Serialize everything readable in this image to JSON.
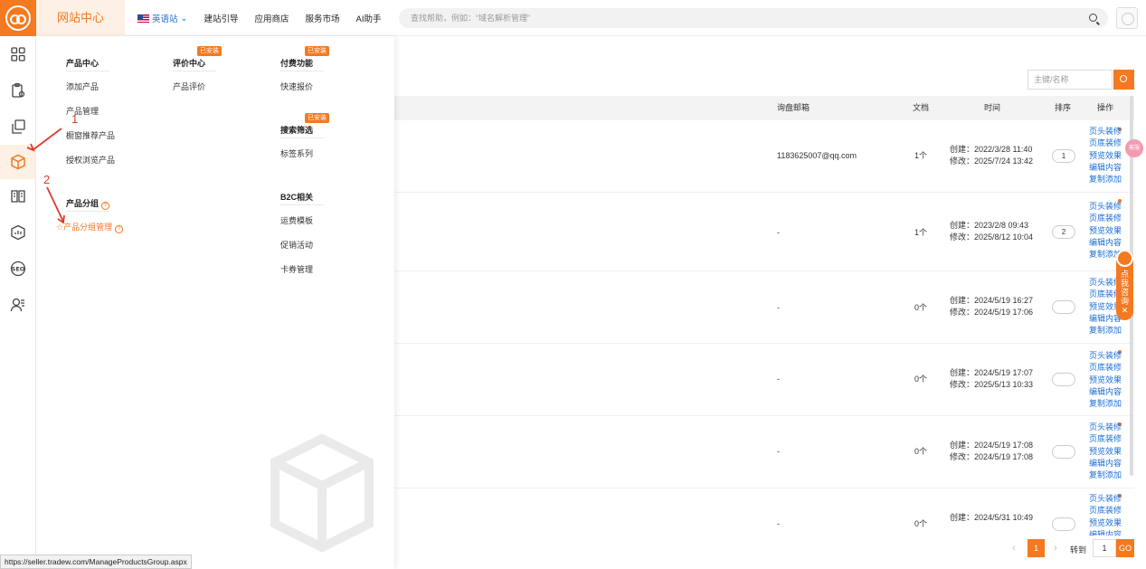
{
  "header": {
    "brand": "网站中心",
    "site_selector": "英语站",
    "nav": [
      "建站引导",
      "应用商店",
      "服务市场",
      "AI助手"
    ],
    "search_placeholder": "查找帮助，例如：“域名解析管理”"
  },
  "menu": {
    "col1": {
      "title": "产品中心",
      "items": [
        "添加产品",
        "产品管理",
        "橱窗推荐产品",
        "授权浏览产品"
      ],
      "group_title": "产品分组",
      "group_item": "产品分组管理"
    },
    "col2": {
      "badge": "已安装",
      "title": "评价中心",
      "items": [
        "产品评价"
      ]
    },
    "col3": {
      "badge1": "已安装",
      "title1": "付费功能",
      "items1": [
        "快速报价"
      ],
      "badge2": "已安装",
      "title2": "搜索筛选",
      "items2": [
        "标签系列"
      ],
      "title3": "B2C相关",
      "items3": [
        "运费模板",
        "促销活动",
        "卡券管理"
      ]
    },
    "annotations": [
      "1",
      "2"
    ]
  },
  "table": {
    "filter_placeholder": "主键/名称",
    "headers": [
      "询盘邮箱",
      "文档",
      "时间",
      "排序",
      "操作"
    ],
    "ops": [
      "页头装修",
      "页底装修",
      "预览效果",
      "编辑内容",
      "复制添加"
    ],
    "rows": [
      {
        "email": "1183625007@qq.com",
        "docs": "1个",
        "created": "创建：2022/3/28 11:40",
        "modified": "修改：2025/7/24 13:42",
        "sort": "1"
      },
      {
        "email": "-",
        "docs": "1个",
        "created": "创建：2023/2/8 09:43",
        "modified": "修改：2025/8/12 10:04",
        "sort": "2"
      },
      {
        "email": "-",
        "docs": "0个",
        "created": "创建：2024/5/19 16:27",
        "modified": "修改：2024/5/19 17:06",
        "sort": ""
      },
      {
        "email": "-",
        "docs": "0个",
        "created": "创建：2024/5/19 17:07",
        "modified": "修改：2025/5/13 10:33",
        "sort": ""
      },
      {
        "email": "-",
        "docs": "0个",
        "created": "创建：2024/5/19 17:08",
        "modified": "修改：2024/5/19 17:08",
        "sort": ""
      },
      {
        "email": "-",
        "docs": "0个",
        "created": "创建：2024/5/31 10:49",
        "modified": "",
        "sort": ""
      }
    ]
  },
  "pagination": {
    "prev": "‹",
    "current": "1",
    "next": "›",
    "goto_label": "转到",
    "goto_value": "1",
    "go": "GO"
  },
  "float": {
    "tab_text": "点我咨询",
    "close": "✕",
    "pink": "客服"
  },
  "status_url": "https://seller.tradew.com/ManageProductsGroup.aspx",
  "colors": {
    "accent": "#f47920",
    "link": "#1a6dd6",
    "annotation": "#e03a2c"
  }
}
